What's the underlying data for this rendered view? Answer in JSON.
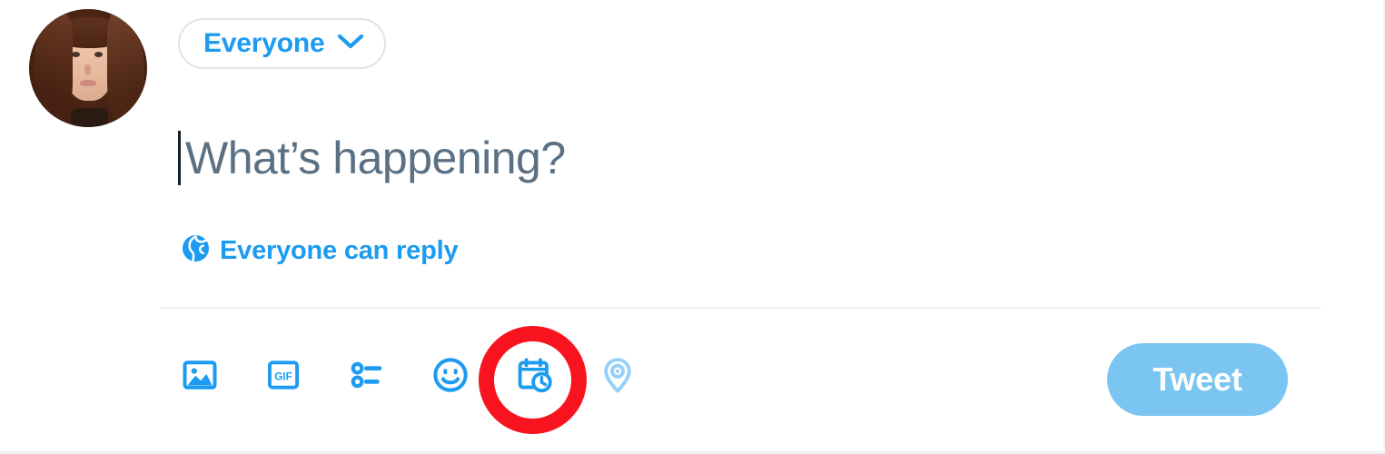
{
  "composer": {
    "audience": {
      "label": "Everyone",
      "icon": "chevron-down-icon"
    },
    "avatar": {
      "alt": "Profile photo"
    },
    "editor": {
      "placeholder": "What’s happening?",
      "value": "",
      "caret_visible": true
    },
    "reply_scope": {
      "icon": "globe-icon",
      "label": "Everyone can reply"
    },
    "toolbar": {
      "items": [
        {
          "name": "media-icon",
          "label": "Media",
          "enabled": true
        },
        {
          "name": "gif-icon",
          "label": "GIF",
          "enabled": true
        },
        {
          "name": "poll-icon",
          "label": "Poll",
          "enabled": true
        },
        {
          "name": "emoji-icon",
          "label": "Emoji",
          "enabled": true
        },
        {
          "name": "schedule-icon",
          "label": "Schedule",
          "enabled": true
        },
        {
          "name": "location-icon",
          "label": "Location",
          "enabled": false
        }
      ],
      "gif_text": "GIF"
    },
    "submit": {
      "label": "Tweet",
      "enabled": false
    },
    "annotation": {
      "shape": "circle",
      "targets": "schedule-icon",
      "color": "#f7141f"
    },
    "colors": {
      "accent": "#1d9bf0",
      "accent_muted": "#7ac5f2",
      "placeholder_text": "#5b7083",
      "divider": "#eef1f3",
      "pill_border": "#dde3e8",
      "annotation_red": "#f7141f",
      "background": "#ffffff"
    }
  }
}
